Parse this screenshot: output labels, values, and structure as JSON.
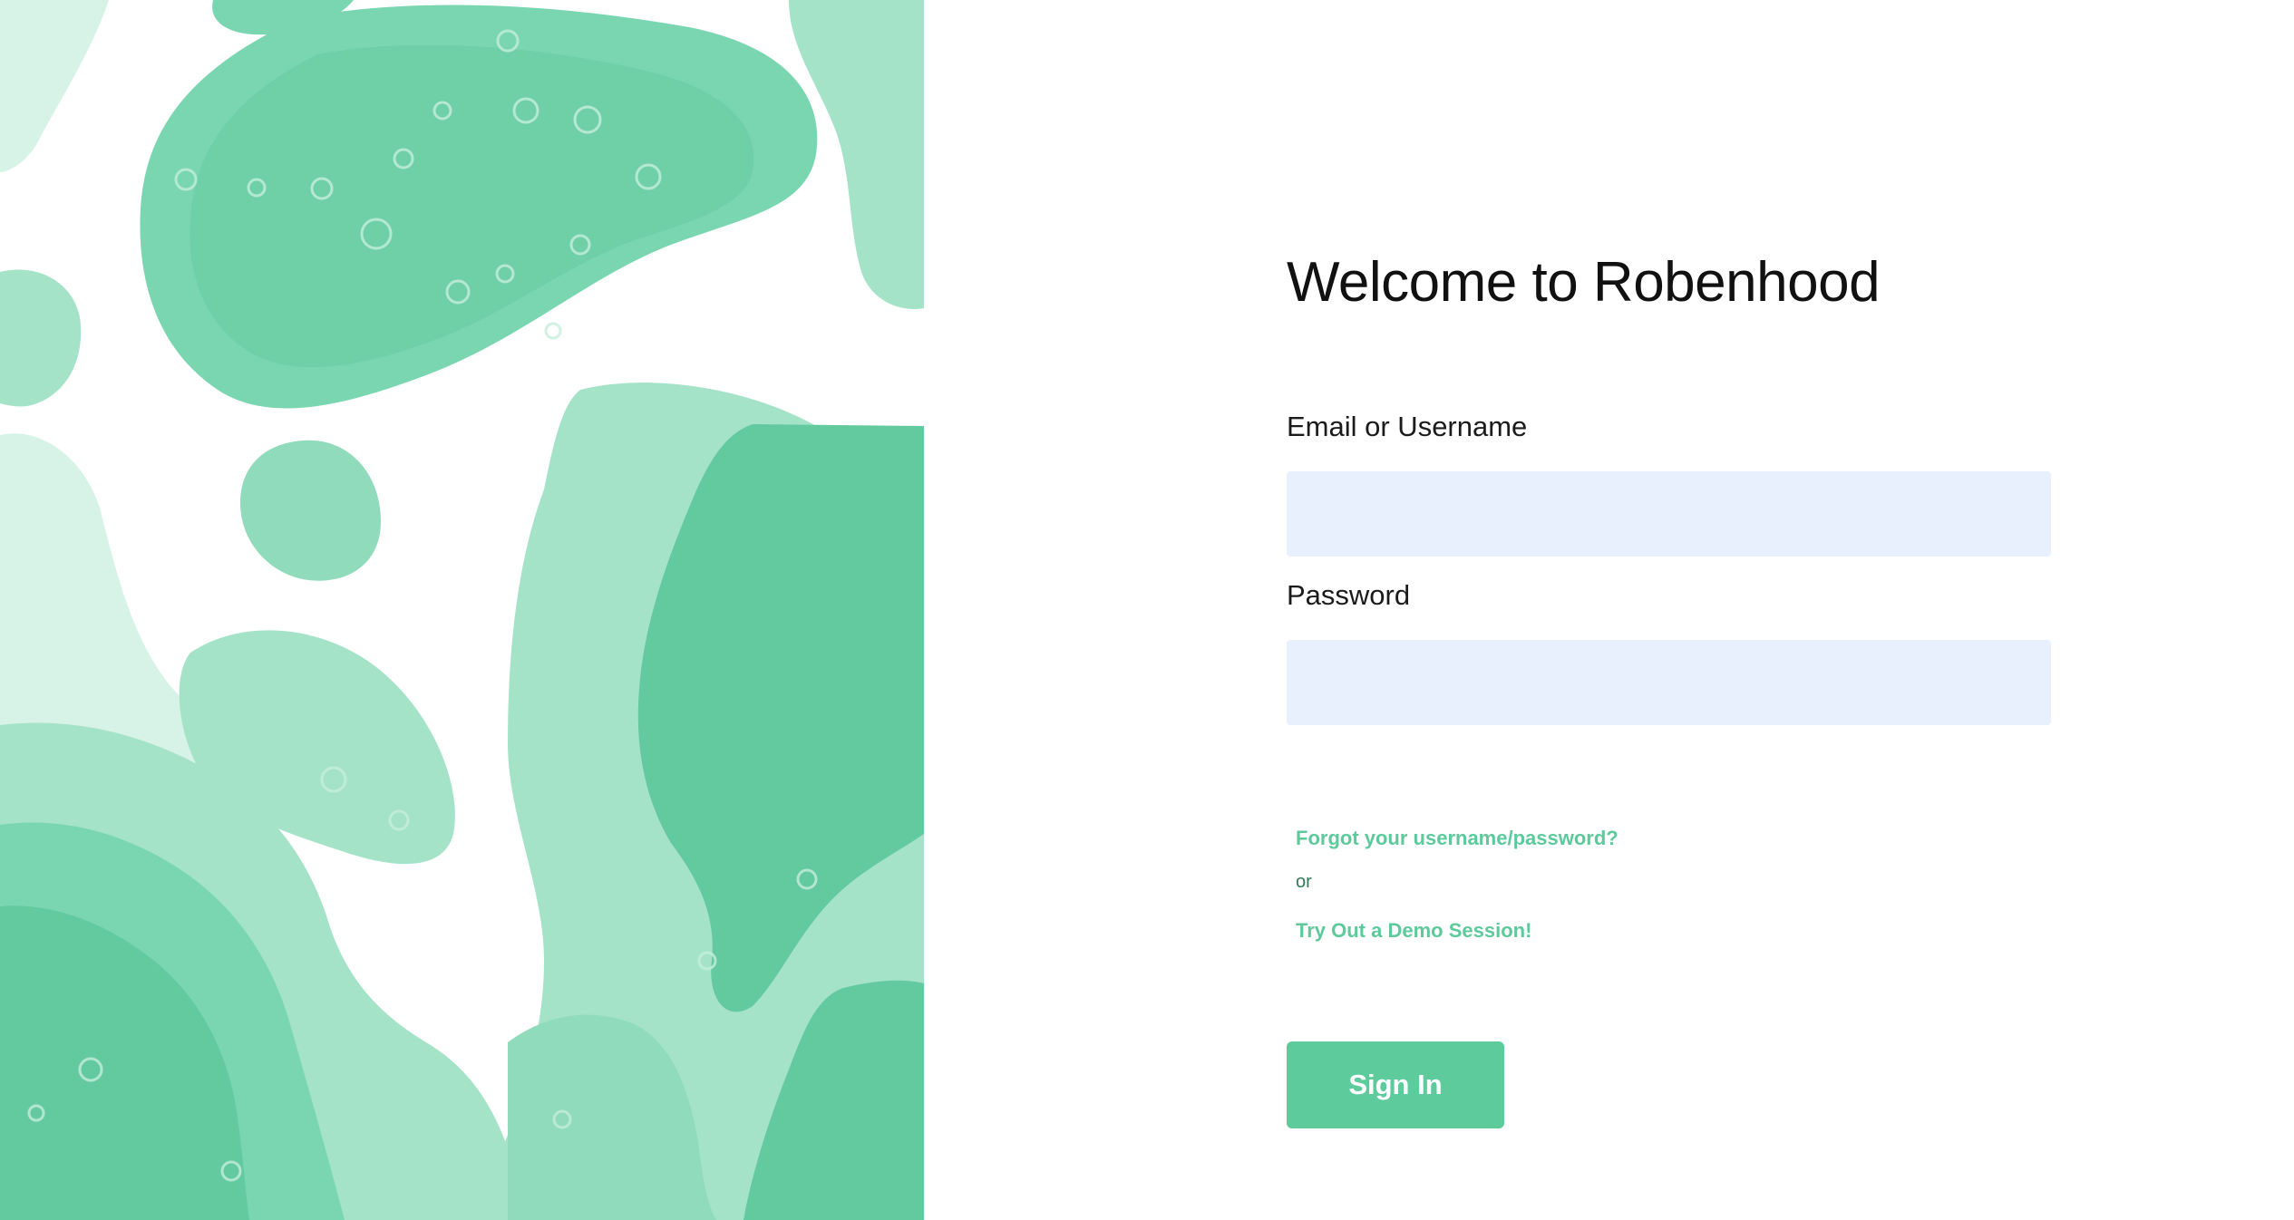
{
  "decoration": {
    "name": "green-watercolor-blobs",
    "colors": {
      "light": "#d7f2e6",
      "mid": "#a5e3c9",
      "strong": "#7ad6b1",
      "deep": "#63c99e",
      "shadow": "#54bc90"
    }
  },
  "login": {
    "title": "Welcome to Robenhood",
    "email_label": "Email or Username",
    "email_value": "",
    "password_label": "Password",
    "password_value": "",
    "forgot_link": "Forgot your username/password?",
    "or_text": "or",
    "demo_link": "Try Out a Demo Session!",
    "sign_in_label": "Sign In"
  },
  "colors": {
    "accent": "#5ecb9c",
    "input_background": "#e8f0fd",
    "title_text": "#111111"
  }
}
